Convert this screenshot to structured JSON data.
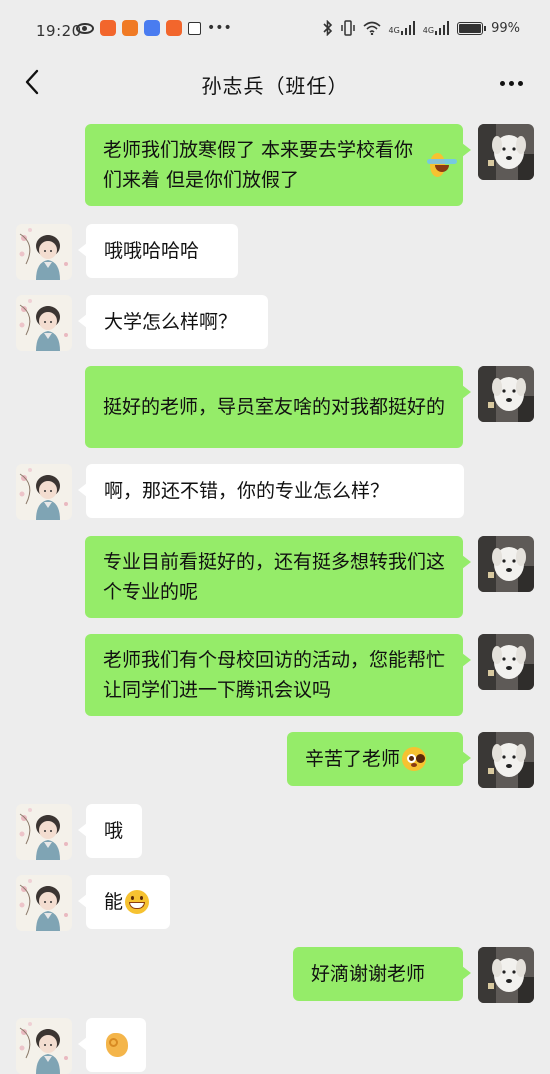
{
  "status_bar": {
    "time": "19:20",
    "net_left": "4G",
    "net_right": "4G",
    "battery": "99%"
  },
  "header": {
    "title": "孙志兵（班任）"
  },
  "icons": {
    "back": "chevron-left-icon",
    "more": "more-horizontal-icon"
  },
  "colors": {
    "me_bubble": "#95ec69",
    "them_bubble": "#ffffff",
    "background": "#ededed"
  },
  "messages": [
    {
      "sender": "me",
      "text": "老师我们放寒假了 本来要去学校看你们来着 但是你们放假了",
      "emoji": "laugh-crying"
    },
    {
      "sender": "them",
      "text": "哦哦哈哈哈"
    },
    {
      "sender": "them",
      "text": "大学怎么样啊？"
    },
    {
      "sender": "me",
      "text": "挺好的老师，导员室友啥的对我都挺好的"
    },
    {
      "sender": "them",
      "text": "啊，那还不错，你的专业怎么样？"
    },
    {
      "sender": "me",
      "text": "专业目前看挺好的，还有挺多想转我们这个专业的呢"
    },
    {
      "sender": "me",
      "text": "老师我们有个母校回访的活动，您能帮忙让同学们进一下腾讯会议吗"
    },
    {
      "sender": "me",
      "text": "辛苦了老师",
      "emoji": "flushed"
    },
    {
      "sender": "them",
      "text": "哦"
    },
    {
      "sender": "them",
      "text": "能",
      "emoji": "grin"
    },
    {
      "sender": "me",
      "text": "好滴谢谢老师"
    },
    {
      "sender": "them",
      "text": "",
      "emoji": "ok-hand"
    }
  ]
}
